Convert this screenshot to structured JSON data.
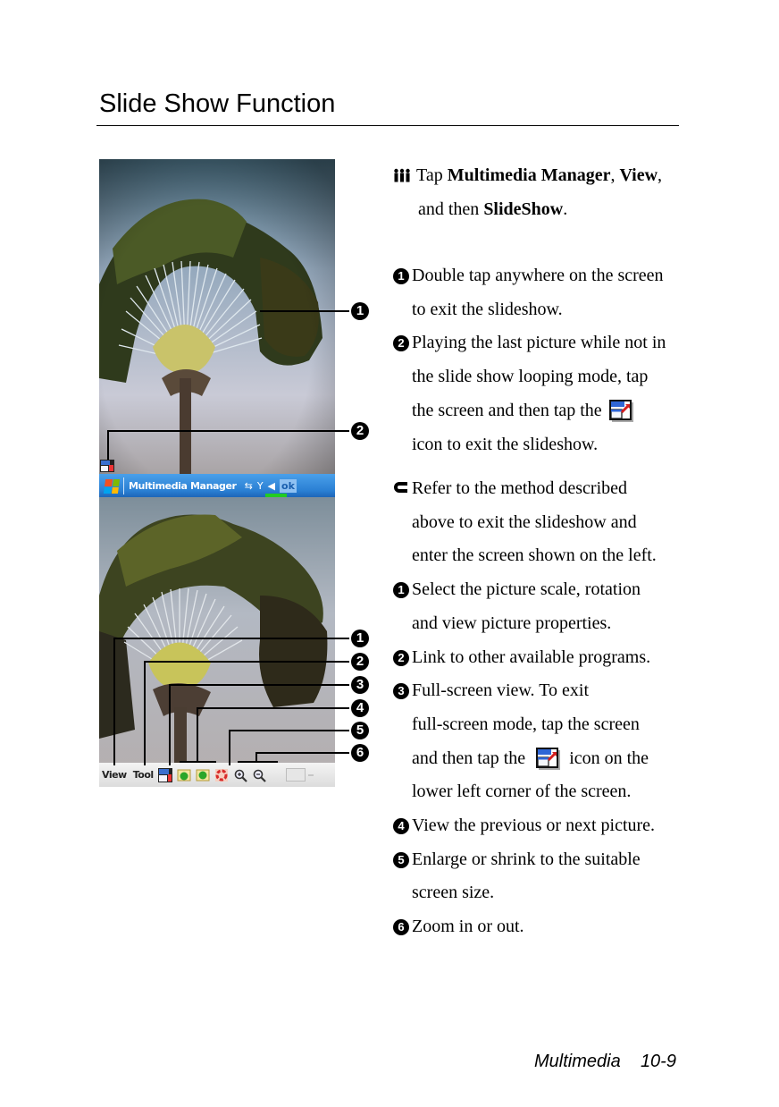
{
  "page": {
    "title": "Slide Show Function",
    "footer": {
      "chapter": "Multimedia",
      "page_number": "10-9"
    }
  },
  "screenshots": {
    "top": {
      "callouts": [
        "1",
        "2"
      ]
    },
    "taskbar": {
      "title": "Multimedia Manager",
      "ok_label": "ok",
      "icons": [
        "windows-start-icon",
        "connectivity-icon",
        "signal-off-icon",
        "volume-icon",
        "battery-indicator"
      ]
    },
    "bottom": {
      "menu": {
        "view_label": "View",
        "tool_label": "Tool"
      },
      "toolbar_icons": [
        "full-screen-icon",
        "previous-picture-icon",
        "next-picture-icon",
        "fit-to-screen-icon",
        "zoom-in-icon",
        "zoom-out-icon",
        "input-panel-icon"
      ],
      "callouts": [
        "1",
        "2",
        "3",
        "4",
        "5",
        "6"
      ]
    }
  },
  "instructions": {
    "intro": {
      "icon": "people-icon",
      "prefix": "Tap ",
      "bold1": "Multimedia Manager",
      "sep1": ", ",
      "bold2": "View",
      "sep2": ",",
      "line2_prefix": "and then ",
      "bold3": "SlideShow",
      "line2_suffix": "."
    },
    "slideshow_items": [
      {
        "marker": "1",
        "lines": [
          "Double tap anywhere on the screen",
          "to exit the slideshow."
        ]
      },
      {
        "marker": "2",
        "lines": [
          "Playing the last picture while not in",
          "the slide show looping mode, tap",
          "the screen and then tap the",
          "icon to exit the slideshow."
        ]
      }
    ],
    "refer": {
      "icon": "arrow-icon",
      "lines": [
        "Refer to the method described",
        "above to exit the slideshow and",
        "enter the screen shown on the left."
      ]
    },
    "toolbar_items": [
      {
        "marker": "1",
        "lines": [
          "Select the picture scale, rotation",
          "and view picture properties."
        ]
      },
      {
        "marker": "2",
        "lines": [
          "Link to other available programs."
        ]
      },
      {
        "marker": "3",
        "lines": [
          "Full-screen view. To exit",
          "full-screen mode, tap the screen",
          "and then tap the",
          "icon on the",
          "lower left corner of the screen."
        ]
      },
      {
        "marker": "4",
        "lines": [
          "View the previous or next picture."
        ]
      },
      {
        "marker": "5",
        "lines": [
          "Enlarge or shrink to the suitable",
          "screen size."
        ]
      },
      {
        "marker": "6",
        "lines": [
          "Zoom in or out."
        ]
      }
    ]
  }
}
